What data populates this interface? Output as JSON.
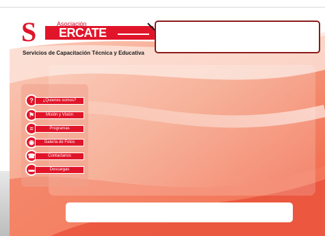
{
  "logo": {
    "small_text": "Asociación",
    "s_letter": "S",
    "word": "ERCATE",
    "tagline": "Servicios de Capacitación Técnica y Educativa"
  },
  "menu": {
    "items": [
      {
        "label": "¿Quienes somos?",
        "icon": "question-icon"
      },
      {
        "label": "Misión y Visión",
        "icon": "flag-icon"
      },
      {
        "label": "Programas",
        "icon": "document-icon"
      },
      {
        "label": "Galería de Fotos",
        "icon": "camera-icon"
      },
      {
        "label": "Contactanos",
        "icon": "phone-icon"
      },
      {
        "label": "Descargas",
        "icon": "folder-icon"
      }
    ]
  },
  "colors": {
    "brand_red": "#e1152a",
    "dark_red": "#8b1a1a",
    "bg_orange": "#f26d50"
  }
}
